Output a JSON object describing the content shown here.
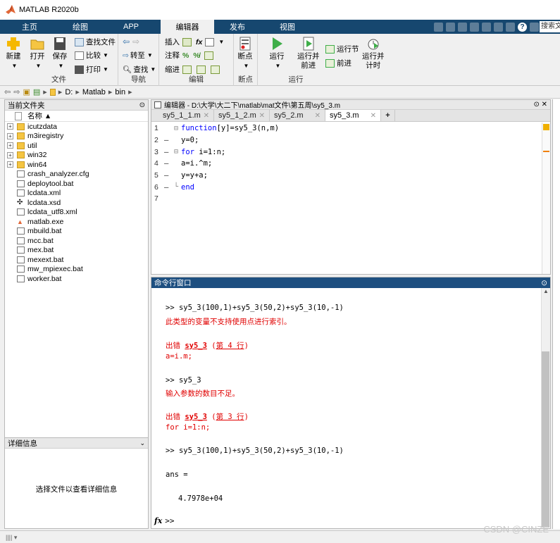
{
  "window": {
    "title": "MATLAB R2020b"
  },
  "tabs": [
    {
      "label": "主页",
      "active": false
    },
    {
      "label": "绘图",
      "active": false
    },
    {
      "label": "APP",
      "active": false
    },
    {
      "label": "编辑器",
      "active": true
    },
    {
      "label": "发布",
      "active": false
    },
    {
      "label": "视图",
      "active": false
    }
  ],
  "search": {
    "placeholder": "搜索文"
  },
  "ribbon": {
    "file": {
      "group_label": "文件",
      "new": "新建",
      "open": "打开",
      "save": "保存",
      "find_files": "查找文件",
      "compare": "比较",
      "print": "打印"
    },
    "navigate": {
      "group_label": "导航",
      "goto": "转至",
      "find": "查找"
    },
    "edit": {
      "group_label": "编辑",
      "insert": "插入",
      "comment": "注释",
      "indent": "缩进"
    },
    "breakpoints": {
      "group_label": "断点",
      "label": "断点"
    },
    "run": {
      "group_label": "运行",
      "run": "运行",
      "run_advance": "运行并\n前进",
      "run_section": "运行节",
      "advance": "前进",
      "run_time": "运行并\n计时"
    }
  },
  "address": {
    "path": [
      "D:",
      "Matlab",
      "bin"
    ]
  },
  "current_folder": {
    "title": "当前文件夹",
    "column_name": "名称 ▲",
    "items": [
      {
        "name": "icutzdata",
        "type": "folder"
      },
      {
        "name": "m3iregistry",
        "type": "folder"
      },
      {
        "name": "util",
        "type": "folder"
      },
      {
        "name": "win32",
        "type": "folder"
      },
      {
        "name": "win64",
        "type": "folder"
      },
      {
        "name": "crash_analyzer.cfg",
        "type": "file"
      },
      {
        "name": "deploytool.bat",
        "type": "file"
      },
      {
        "name": "lcdata.xml",
        "type": "file"
      },
      {
        "name": "lcdata.xsd",
        "type": "xsd"
      },
      {
        "name": "lcdata_utf8.xml",
        "type": "file"
      },
      {
        "name": "matlab.exe",
        "type": "exe"
      },
      {
        "name": "mbuild.bat",
        "type": "file"
      },
      {
        "name": "mcc.bat",
        "type": "file"
      },
      {
        "name": "mex.bat",
        "type": "file"
      },
      {
        "name": "mexext.bat",
        "type": "file"
      },
      {
        "name": "mw_mpiexec.bat",
        "type": "file"
      },
      {
        "name": "worker.bat",
        "type": "file"
      }
    ]
  },
  "details": {
    "title": "详细信息",
    "placeholder": "选择文件以查看详细信息"
  },
  "editor": {
    "title": "编辑器 - D:\\大学\\大二下\\matlab\\mat文件\\第五周\\sy5_3.m",
    "tabs": [
      {
        "label": "sy5_1_1.m",
        "active": false
      },
      {
        "label": "sy5_1_2.m",
        "active": false
      },
      {
        "label": "sy5_2.m",
        "active": false
      },
      {
        "label": "sy5_3.m",
        "active": true
      }
    ],
    "lines": [
      {
        "num": "1",
        "dash": "",
        "fold": "⊟",
        "kw": "function",
        "rest": "[y]=sy5_3(n,m)"
      },
      {
        "num": "2",
        "dash": "—",
        "fold": "",
        "kw": "",
        "rest": "y=0;"
      },
      {
        "num": "3",
        "dash": "—",
        "fold": "⊟",
        "kw": "for",
        "rest": " i=1:n;"
      },
      {
        "num": "4",
        "dash": "—",
        "fold": "",
        "kw": "",
        "rest": "a=i.^m;"
      },
      {
        "num": "5",
        "dash": "—",
        "fold": "",
        "kw": "",
        "rest": "y=y+a;"
      },
      {
        "num": "6",
        "dash": "—",
        "fold": "└",
        "kw": "end",
        "rest": ""
      },
      {
        "num": "7",
        "dash": "",
        "fold": "",
        "kw": "",
        "rest": ""
      }
    ]
  },
  "command_window": {
    "title": "命令行窗口",
    "lines": {
      "l1": ">> sy5_3(100,1)+sy5_3(50,2)+sy5_3(10,-1)",
      "l2": "此类型的变量不支持使用点进行索引。",
      "l3_a": "出错 ",
      "l3_b": "sy5_3",
      "l3_c": " (",
      "l3_d": "第 4 行",
      "l3_e": ")",
      "l4": "a=i.m;",
      "l5": ">> sy5_3",
      "l6": "输入参数的数目不足。",
      "l7_a": "出错 ",
      "l7_b": "sy5_3",
      "l7_c": " (",
      "l7_d": "第 3 行",
      "l7_e": ")",
      "l8": "for i=1:n;",
      "l9": ">> sy5_3(100,1)+sy5_3(50,2)+sy5_3(10,-1)",
      "l10": "ans =",
      "l11": "4.7978e+04"
    },
    "prompt": ">>"
  },
  "watermark": "CSDN @CINZE"
}
